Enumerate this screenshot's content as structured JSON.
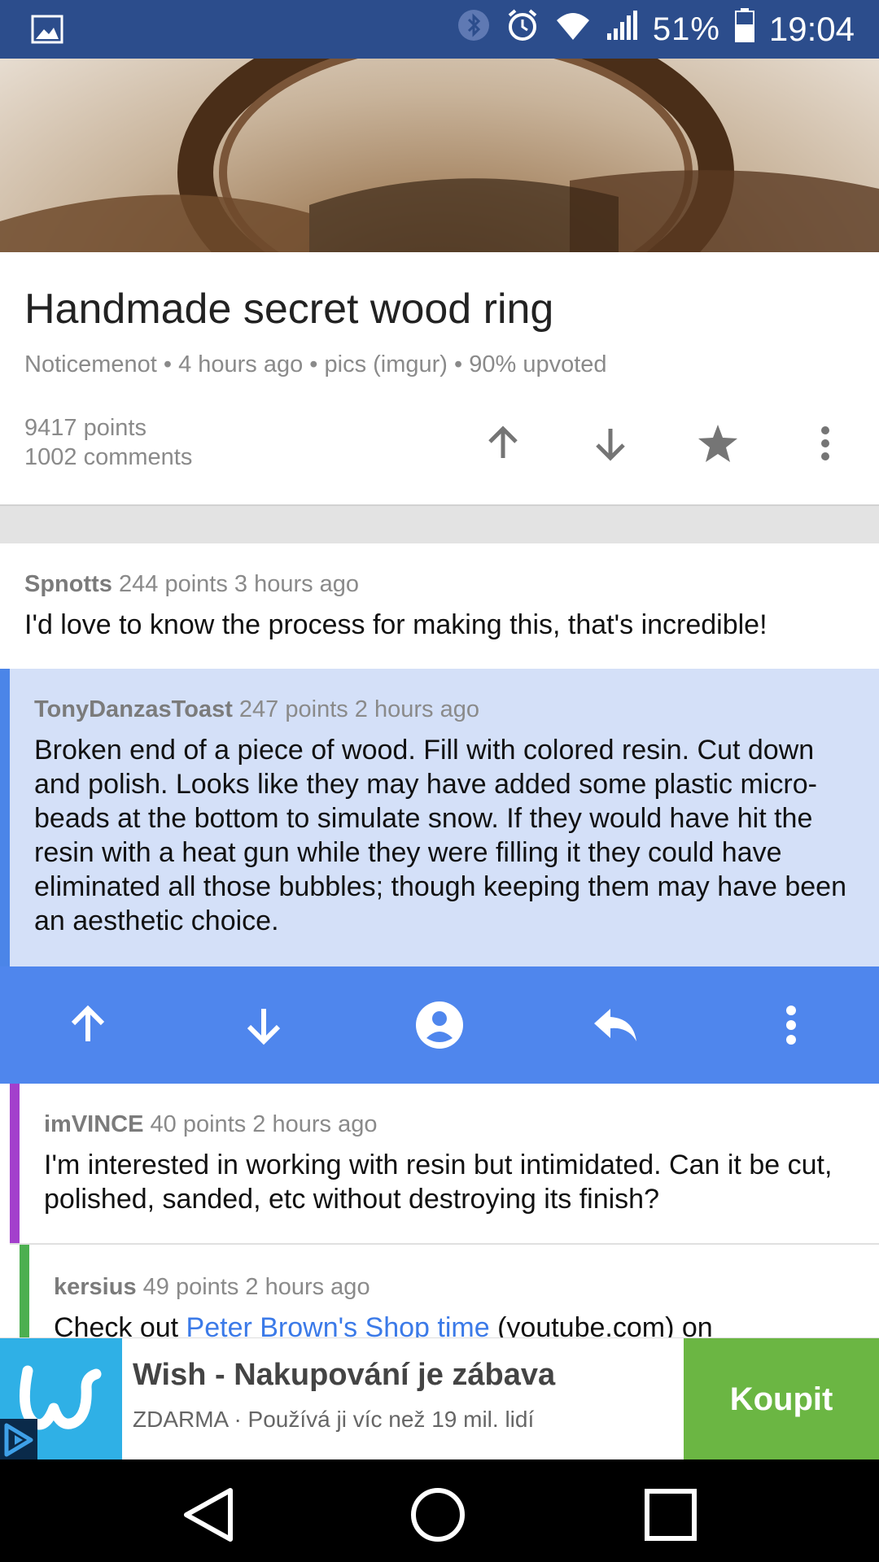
{
  "status_bar": {
    "battery_percent": "51%",
    "time": "19:04"
  },
  "post": {
    "title": "Handmade secret wood ring",
    "meta": "Noticemenot • 4 hours ago • pics (imgur) • 90% upvoted",
    "points": "9417 points",
    "comments": "1002 comments"
  },
  "comments": [
    {
      "author": "Spnotts",
      "info": "244 points 3 hours ago",
      "body": "I'd love to know the process for making this, that's incredible!"
    },
    {
      "author": "TonyDanzasToast",
      "info": "247 points 2 hours ago",
      "body": "Broken end of a piece of wood. Fill with colored resin. Cut down and polish. Looks like they may have added some plastic micro-beads at the bottom to simulate snow. If they would have hit the resin with a heat gun while they were filling it they could have eliminated all those bubbles; though keeping them may have been an aesthetic choice."
    },
    {
      "author": "imVINCE",
      "info": "40 points 2 hours ago",
      "body": "I'm interested in working with resin but intimidated. Can it be cut, polished, sanded, etc without destroying its finish?"
    },
    {
      "author": "kersius",
      "info": "49 points 2 hours ago",
      "body_prefix": "Check out ",
      "link": "Peter Brown's Shop time",
      "body_suffix": " (youtube.com) on"
    }
  ],
  "ad": {
    "title": "Wish - Nakupování je zábava",
    "subtitle": "ZDARMA · Používá ji víc než 19 mil. lidí",
    "button": "Koupit"
  },
  "colors": {
    "status_bar": "#2c4d8c",
    "selected_comment_bg": "#d4e0f8",
    "action_bar": "#4f86ed",
    "ad_button": "#6bb643"
  }
}
